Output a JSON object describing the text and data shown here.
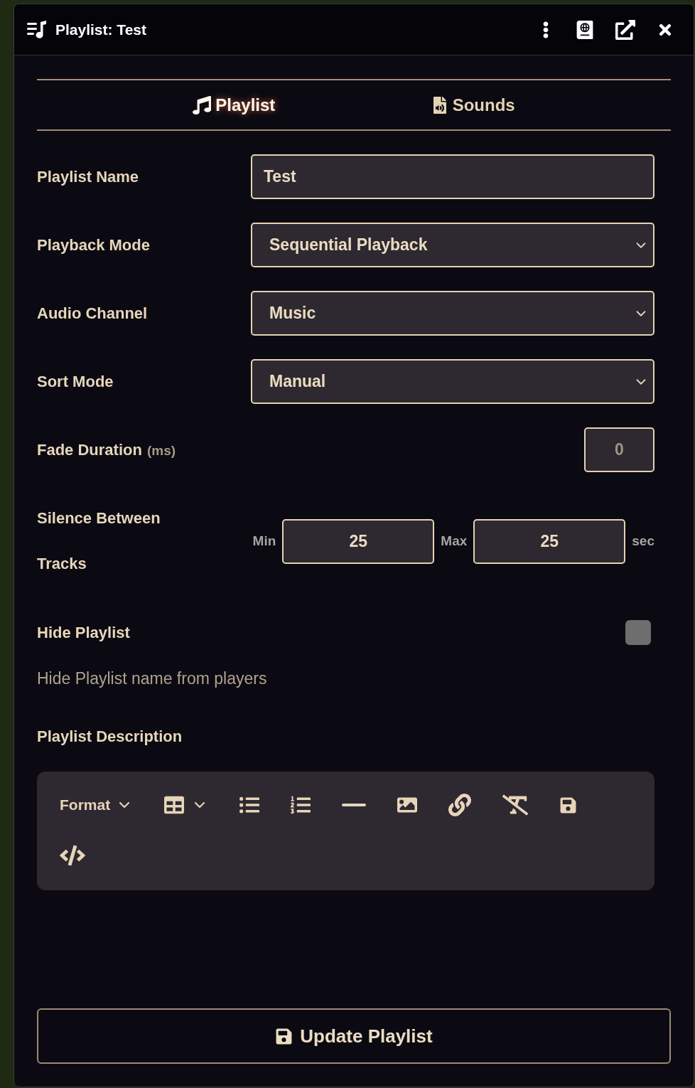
{
  "window": {
    "title": "Playlist: Test"
  },
  "tabs": [
    {
      "label": "Playlist",
      "selected": true
    },
    {
      "label": "Sounds",
      "selected": false
    }
  ],
  "fields": [
    {
      "kind": "text",
      "label": "Playlist Name",
      "value": "Test"
    },
    {
      "kind": "select",
      "label": "Playback Mode",
      "value": "Sequential Playback"
    },
    {
      "kind": "select",
      "label": "Audio Channel",
      "value": "Music"
    },
    {
      "kind": "select",
      "label": "Sort Mode",
      "value": "Manual"
    },
    {
      "kind": "number",
      "label": "Fade Duration",
      "unit": "(ms)",
      "placeholder": "0"
    },
    {
      "kind": "range",
      "label": "Silence Between Tracks",
      "min_label": "Min",
      "min_value": "25",
      "max_label": "Max",
      "max_value": "25",
      "unit": "sec"
    },
    {
      "kind": "checkbox",
      "label": "Hide Playlist",
      "checked": false,
      "hint": "Hide Playlist name from players"
    }
  ],
  "description": {
    "label": "Playlist Description",
    "format_menu": "Format"
  },
  "submit": {
    "label": "Update Playlist"
  }
}
